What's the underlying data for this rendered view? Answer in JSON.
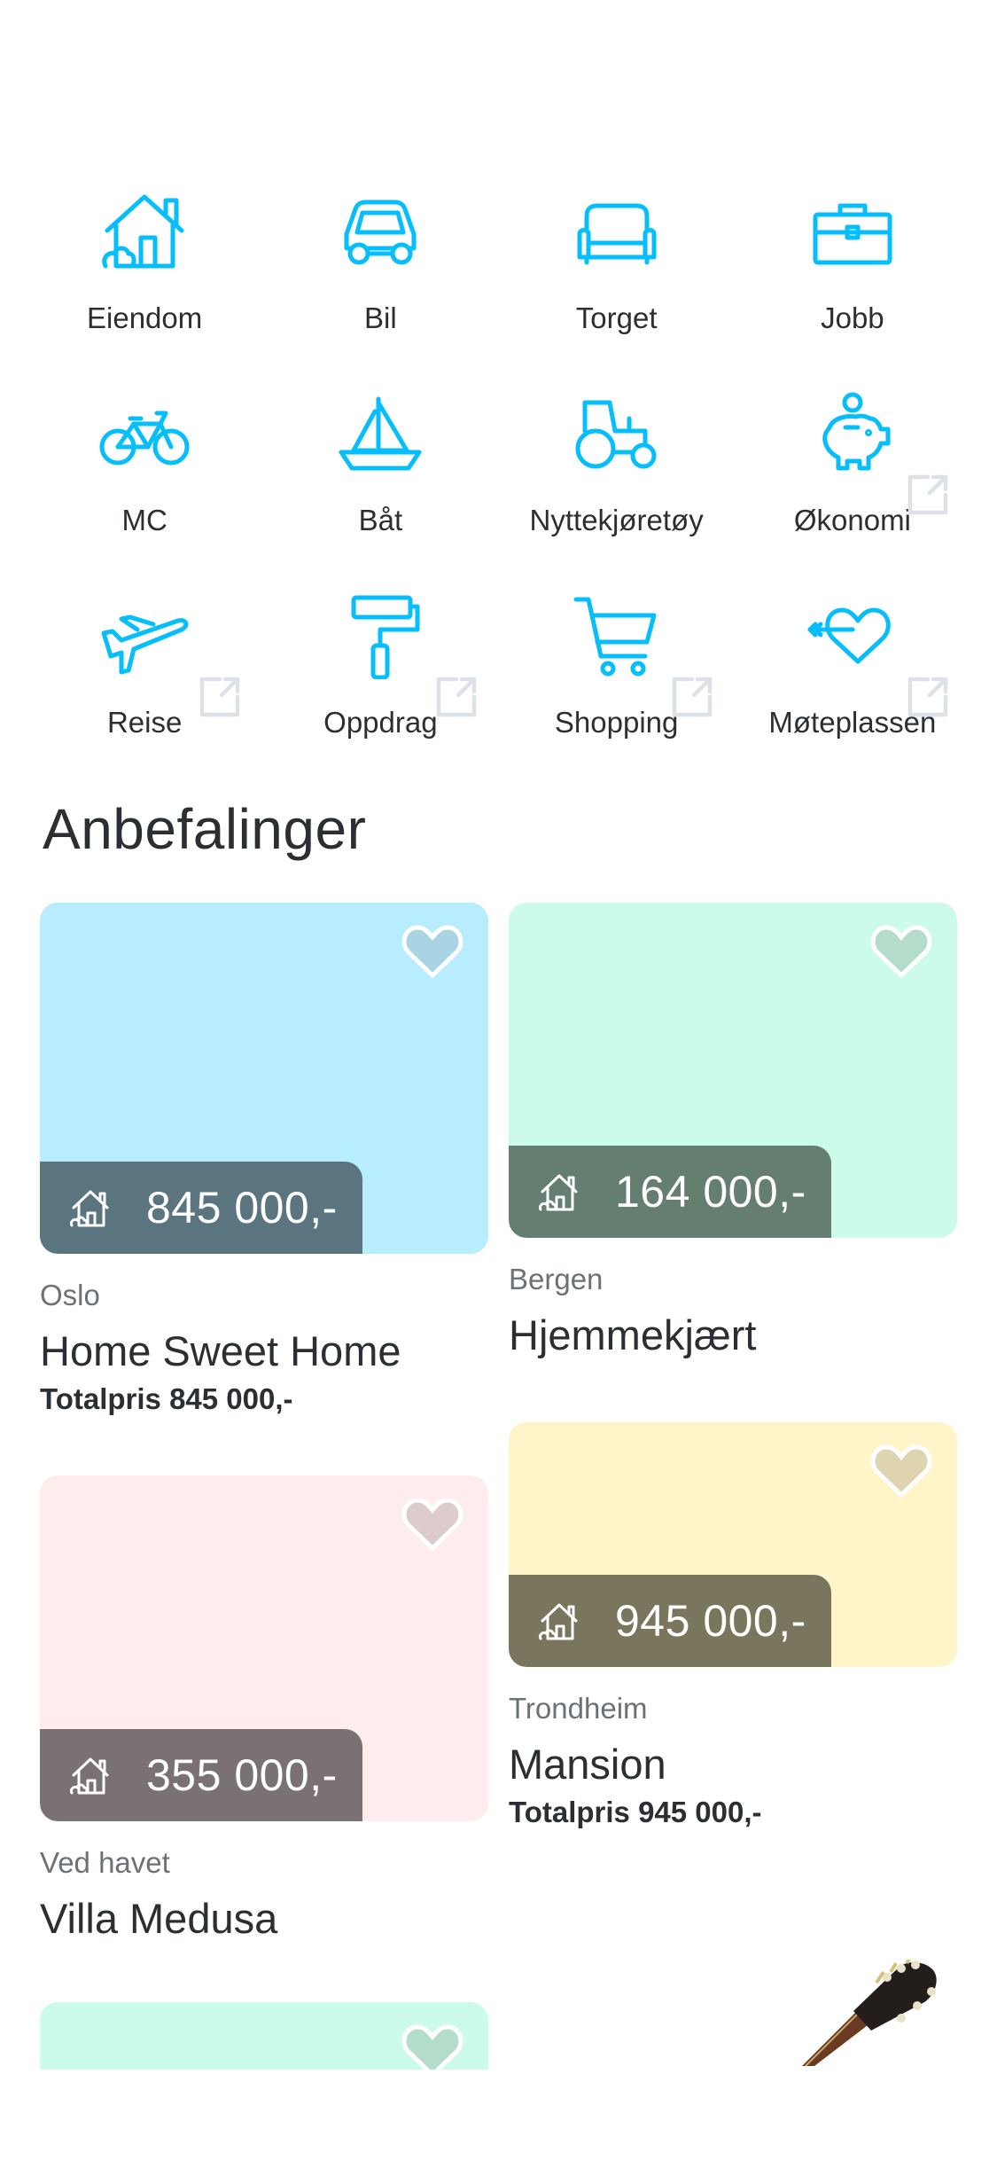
{
  "categories": [
    {
      "label": "Eiendom",
      "icon": "house-icon",
      "external": false
    },
    {
      "label": "Bil",
      "icon": "car-icon",
      "external": false
    },
    {
      "label": "Torget",
      "icon": "sofa-icon",
      "external": false
    },
    {
      "label": "Jobb",
      "icon": "briefcase-icon",
      "external": false
    },
    {
      "label": "MC",
      "icon": "bicycle-icon",
      "external": false
    },
    {
      "label": "Båt",
      "icon": "sailboat-icon",
      "external": false
    },
    {
      "label": "Nyttekjøretøy",
      "icon": "tractor-icon",
      "external": false
    },
    {
      "label": "Økonomi",
      "icon": "piggy-bank-icon",
      "external": true
    },
    {
      "label": "Reise",
      "icon": "airplane-icon",
      "external": true
    },
    {
      "label": "Oppdrag",
      "icon": "paint-roller-icon",
      "external": true
    },
    {
      "label": "Shopping",
      "icon": "shopping-cart-icon",
      "external": true
    },
    {
      "label": "Møteplassen",
      "icon": "heart-arrow-icon",
      "external": true
    }
  ],
  "recommendations": {
    "title": "Anbefalinger",
    "cards": [
      {
        "price": "845 000,-",
        "location": "Oslo",
        "title": "Home Sweet Home",
        "total": "Totalpris 845 000,-",
        "bg": "#b8ecff",
        "badge": "#5a7480",
        "heart_fill": "#a8d4e4"
      },
      {
        "price": "164 000,-",
        "location": "Bergen",
        "title": "Hjemmekjært",
        "total": "",
        "bg": "#ccfce9",
        "badge": "#657e72",
        "heart_fill": "#b3dccb"
      },
      {
        "price": "355 000,-",
        "location": "Ved havet",
        "title": "Villa Medusa",
        "total": "",
        "bg": "#ffeded",
        "badge": "#7a7272",
        "heart_fill": "#dccccc"
      },
      {
        "price": "945 000,-",
        "location": "Trondheim",
        "title": "Mansion",
        "total": "Totalpris 945 000,-",
        "bg": "#fff5c9",
        "badge": "#7a765e",
        "heart_fill": "#ded5b0"
      },
      {
        "price": "",
        "location": "",
        "title": "",
        "total": "",
        "bg": "#ccfce9",
        "badge": "#657e72",
        "heart_fill": "#b3dccb"
      }
    ]
  },
  "colors": {
    "accent": "#06befb",
    "external_icon": "#dde2e8",
    "text": "#2b2f33",
    "muted": "#6b7177"
  }
}
